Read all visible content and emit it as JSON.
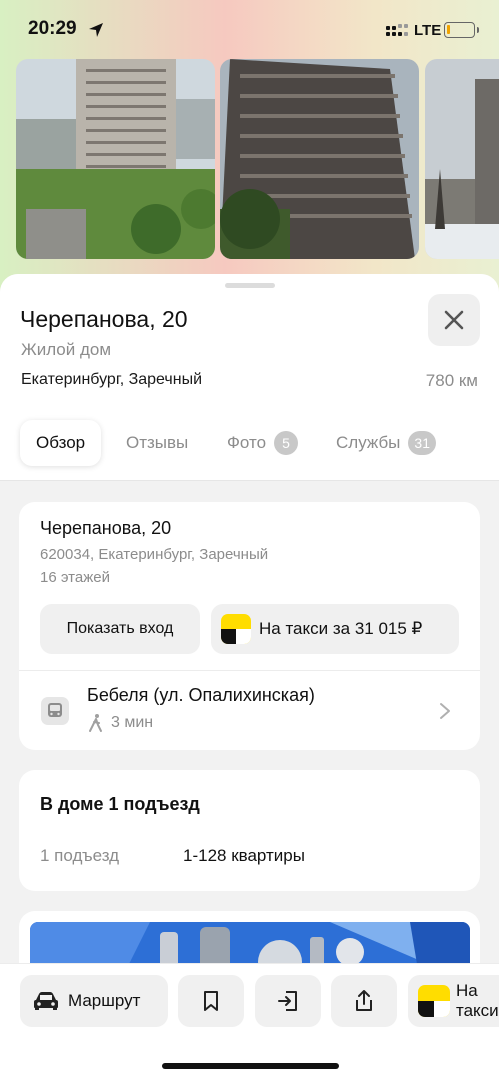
{
  "status_bar": {
    "time": "20:29",
    "network": "LTE"
  },
  "place": {
    "title": "Черепанова, 20",
    "category": "Жилой дом",
    "city": "Екатеринбург, Заречный",
    "distance": "780 км"
  },
  "tabs": [
    {
      "label": "Обзор",
      "badge": ""
    },
    {
      "label": "Отзывы",
      "badge": ""
    },
    {
      "label": "Фото",
      "badge": "5"
    },
    {
      "label": "Службы",
      "badge": "31"
    }
  ],
  "address_card": {
    "street": "Черепанова, 20",
    "postal": "620034, Екатеринбург, Заречный",
    "floors": "16 этажей",
    "entrance_button": "Показать вход",
    "taxi_button": "На такси за 31 015 ₽",
    "stop_name": "Бебеля (ул. Опалихинская)",
    "walk_time": "3 мин"
  },
  "entrances_card": {
    "title": "В доме 1 подъезд",
    "count": "1 подъезд",
    "flats": "1-128 квартиры"
  },
  "bottom_bar": {
    "route_label": "Маршрут",
    "taxi_label": "На такси"
  },
  "colors": {
    "taxi_yellow": "#ffdd00",
    "badge_gray": "#c8c8c8",
    "text_secondary": "#8c8c8c"
  }
}
